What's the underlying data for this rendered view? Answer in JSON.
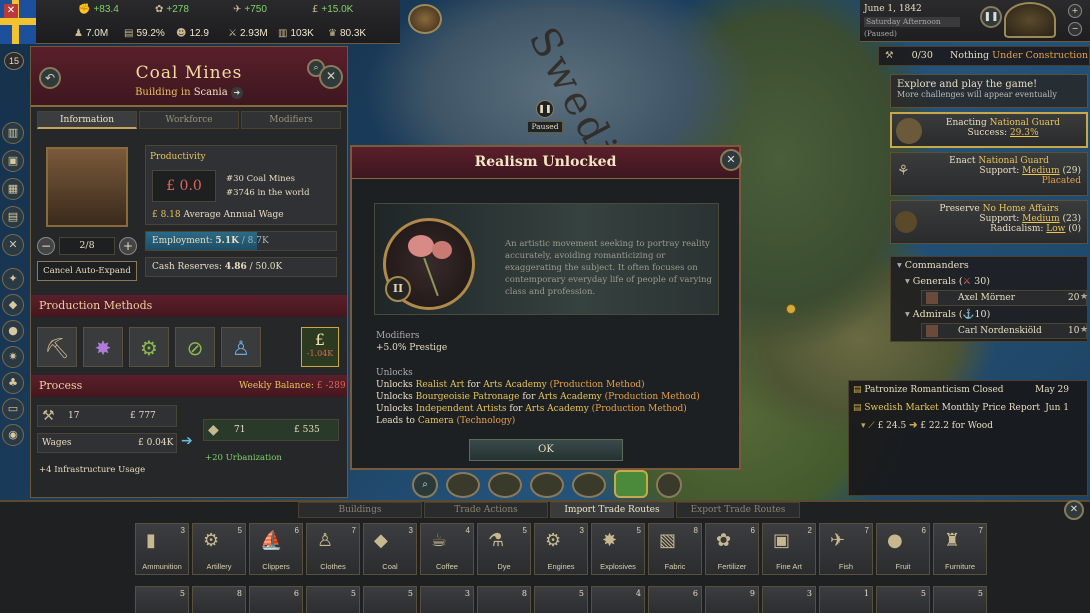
{
  "map": {
    "label": "Swedish Market",
    "paused_label": "Paused"
  },
  "topbar": {
    "stats_row1": [
      {
        "icon": "authority-icon",
        "value": "+83.4"
      },
      {
        "icon": "influence-icon",
        "value": "+278"
      },
      {
        "icon": "dove-icon",
        "value": "+750"
      },
      {
        "icon": "money-icon",
        "value": "+15.0K"
      }
    ],
    "stats_row2": [
      {
        "icon": "population-icon",
        "value": "7.0M"
      },
      {
        "icon": "literacy-icon",
        "value": "59.2%"
      },
      {
        "icon": "sol-icon",
        "value": "12.9"
      },
      {
        "icon": "army-icon",
        "value": "2.93M"
      },
      {
        "icon": "gdp-icon",
        "value": "103K"
      },
      {
        "icon": "prestige-icon",
        "value": "80.3K"
      }
    ],
    "alert_count": "15"
  },
  "date": {
    "date": "June 1, 1842",
    "time": "Saturday Afternoon",
    "state": "(Paused)"
  },
  "construction": {
    "count": "0/30",
    "text_prefix": "Nothing ",
    "text_highlight": "Under Construction"
  },
  "right": {
    "tip_title": "Explore and play the game!",
    "tip_sub": "More challenges will appear eventually",
    "enacting_prefix": "Enacting ",
    "enacting_law": "National Guard",
    "success_prefix": "Success: ",
    "success_value": "29.3%",
    "enact_prefix": "Enact ",
    "enact_law": "National Guard",
    "support_label": "Support: ",
    "support_1": "Medium",
    "support_1_count": "(29)",
    "placated": "Placated",
    "preserve_prefix": "Preserve ",
    "preserve_law": "No Home Affairs",
    "support_2": "Medium",
    "support_2_count": "(23)",
    "radicalism_label": "Radicalism: ",
    "radicalism_value": "Low",
    "radicalism_count": "(0)",
    "commanders": "Commanders",
    "generals": "Generals",
    "generals_count": "30",
    "general_name": "Axel Mörner",
    "general_value": "20",
    "admirals": "Admirals",
    "admirals_count": "10",
    "admiral_name": "Carl Nordenskiöld",
    "admiral_value": "10",
    "news": [
      {
        "text": "Patronize Romanticism Closed",
        "date": "May 29"
      },
      {
        "text_highlight": "Swedish Market",
        "text": " Monthly Price Report",
        "date": "Jun 1"
      }
    ],
    "price_1": "£ 24.5",
    "price_2": "£ 22.2",
    "price_suffix": " for Wood"
  },
  "building": {
    "title": "Coal Mines",
    "subtitle_prefix": "Building in ",
    "subtitle_place": "Scania",
    "tabs": [
      "Information",
      "Workforce",
      "Modifiers"
    ],
    "productivity_label": "Productivity",
    "productivity_value": "£ 0.0",
    "rank_1": "#30 Coal Mines",
    "rank_2": "#3746 in the world",
    "wage_value": "£ 8.18",
    "wage_label": " Average Annual Wage",
    "level": "2/8",
    "cancel_label": "Cancel Auto-Expand",
    "employment_label": "Employment: ",
    "employment_value": "5.1K",
    "employment_max": " / 8.7K",
    "employment_fraction": 0.586,
    "cash_label": "Cash Reserves: ",
    "cash_value": "4.86",
    "cash_max": " / 50.0K",
    "production_methods": "Production Methods",
    "pm_badge": "-1.04K",
    "process": "Process",
    "weekly_label": "Weekly Balance: ",
    "weekly_value": "£ -289",
    "input_count": "17",
    "input_price": "£ 777",
    "wages_label": "Wages",
    "wages_value": "£ 0.04K",
    "infra": "+4 Infrastructure Usage",
    "output_count": "71",
    "output_price": "£ 535",
    "urbanization": "+20 Urbanization"
  },
  "modal": {
    "title": "Realism Unlocked",
    "era": "II",
    "description": "An artistic movement seeking to portray reality accurately, avoiding romanticizing or exaggerating the subject. It often focuses on contemporary everyday life of people of varying class and profession.",
    "modifiers_label": "Modifiers",
    "modifier": "+5.0% Prestige",
    "unlocks_label": "Unlocks",
    "unlocks": [
      {
        "pre": "Unlocks ",
        "a": "Realist Art",
        "mid": " for ",
        "b": "Arts Academy",
        "tail": " (Production Method)"
      },
      {
        "pre": "Unlocks ",
        "a": "Bourgeoisie Patronage",
        "mid": " for ",
        "b": "Arts Academy",
        "tail": " (Production Method)"
      },
      {
        "pre": "Unlocks ",
        "a": "Independent Artists",
        "mid": " for ",
        "b": "Arts Academy",
        "tail": " (Production Method)"
      },
      {
        "pre": "Leads to ",
        "a": "Camera",
        "mid": "",
        "b": "",
        "tail": " (Technology)"
      }
    ],
    "ok_label": "OK"
  },
  "bottom": {
    "tabs": [
      "Buildings",
      "Trade Actions",
      "Import Trade Routes",
      "Export Trade Routes"
    ],
    "goods": [
      {
        "name": "Ammunition",
        "count": "3",
        "icon": "ammunition-icon"
      },
      {
        "name": "Artillery",
        "count": "5",
        "icon": "artillery-icon"
      },
      {
        "name": "Clippers",
        "count": "6",
        "icon": "clippers-icon"
      },
      {
        "name": "Clothes",
        "count": "7",
        "icon": "clothes-icon"
      },
      {
        "name": "Coal",
        "count": "3",
        "icon": "coal-icon"
      },
      {
        "name": "Coffee",
        "count": "4",
        "icon": "coffee-icon"
      },
      {
        "name": "Dye",
        "count": "5",
        "icon": "dye-icon"
      },
      {
        "name": "Engines",
        "count": "3",
        "icon": "engines-icon"
      },
      {
        "name": "Explosives",
        "count": "5",
        "icon": "explosives-icon"
      },
      {
        "name": "Fabric",
        "count": "8",
        "icon": "fabric-icon"
      },
      {
        "name": "Fertilizer",
        "count": "6",
        "icon": "fertilizer-icon"
      },
      {
        "name": "Fine Art",
        "count": "2",
        "icon": "fine-art-icon"
      },
      {
        "name": "Fish",
        "count": "7",
        "icon": "fish-icon"
      },
      {
        "name": "Fruit",
        "count": "6",
        "icon": "fruit-icon"
      },
      {
        "name": "Furniture",
        "count": "7",
        "icon": "furniture-icon"
      }
    ],
    "goods_row2_counts": [
      "5",
      "8",
      "6",
      "5",
      "5",
      "3",
      "8",
      "5",
      "4",
      "6",
      "9",
      "3",
      "1",
      "5",
      "5"
    ]
  }
}
